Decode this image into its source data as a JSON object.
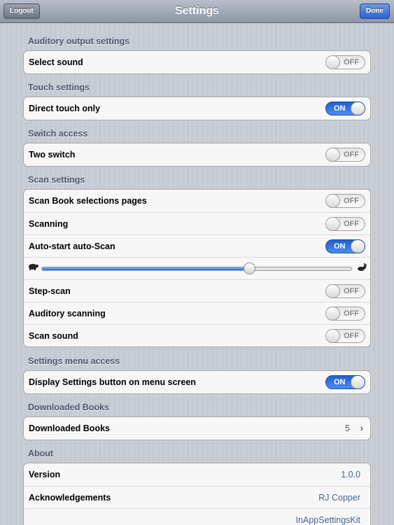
{
  "navbar": {
    "title": "Settings",
    "left_button": "Logout",
    "right_button": "Done"
  },
  "sections": {
    "auditory": {
      "header": "Auditory output settings",
      "rows": [
        {
          "label": "Select sound",
          "toggle": "OFF"
        }
      ]
    },
    "touch": {
      "header": "Touch settings",
      "rows": [
        {
          "label": "Direct touch only",
          "toggle": "ON"
        }
      ]
    },
    "switch": {
      "header": "Switch access",
      "rows": [
        {
          "label": "Two switch",
          "toggle": "OFF"
        }
      ]
    },
    "scan": {
      "header": "Scan settings",
      "rows": [
        {
          "label": "Scan Book selections pages",
          "toggle": "OFF"
        },
        {
          "label": "Scanning",
          "toggle": "OFF"
        },
        {
          "label": "Auto-start auto-Scan",
          "toggle": "ON"
        },
        {
          "label": "Step-scan",
          "toggle": "OFF"
        },
        {
          "label": "Auditory scanning",
          "toggle": "OFF"
        },
        {
          "label": "Scan sound",
          "toggle": "OFF"
        }
      ],
      "speed_slider": {
        "value": 0.67,
        "min_icon": "turtle-icon",
        "max_icon": "rabbit-icon"
      }
    },
    "menu_access": {
      "header": "Settings menu access",
      "rows": [
        {
          "label": "Display Settings button on menu screen",
          "toggle": "ON"
        }
      ]
    },
    "books": {
      "header": "Downloaded Books",
      "rows": [
        {
          "label": "Downloaded Books",
          "value": "5"
        }
      ]
    },
    "about": {
      "header": "About",
      "rows": [
        {
          "label": "Version",
          "value": "1.0.0"
        },
        {
          "label": "Acknowledgements",
          "value": "RJ Copper"
        },
        {
          "label": "",
          "value": "InAppSettingsKit"
        }
      ]
    }
  },
  "colors": {
    "toggle_on": "#2b6ee0",
    "nav_done": "#2a62d0",
    "section_header": "#4c566c"
  }
}
